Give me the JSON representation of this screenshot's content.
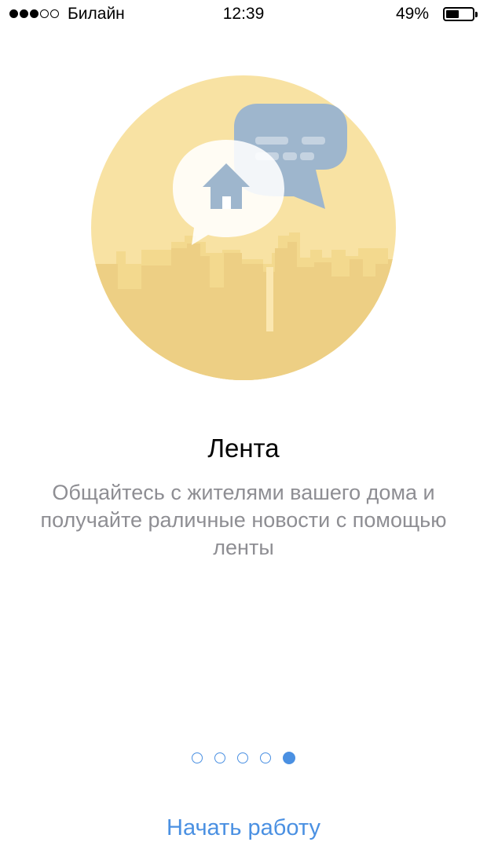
{
  "status_bar": {
    "signal_bars": 3,
    "signal_total": 5,
    "carrier": "Билайн",
    "time": "12:39",
    "battery_percent": "49%",
    "battery_level": 0.49
  },
  "illustration": {
    "description_icons": [
      "house-icon",
      "chat-bubble-icon",
      "city-skyline"
    ],
    "colors": {
      "circle": "#f8e2a3",
      "skyline_far": "#f3d98e",
      "skyline_near": "#edcf84",
      "bubble_blue": "#9eb6cd",
      "house": "#9eb6cd"
    }
  },
  "onboarding": {
    "title": "Лента",
    "description": "Общайтесь с жителями вашего дома и получайте раличные новости с помощью ленты"
  },
  "pager": {
    "count": 5,
    "active_index": 4,
    "color": "#4a90e2"
  },
  "start_button": {
    "label": "Начать работу",
    "color": "#4a90e2"
  }
}
